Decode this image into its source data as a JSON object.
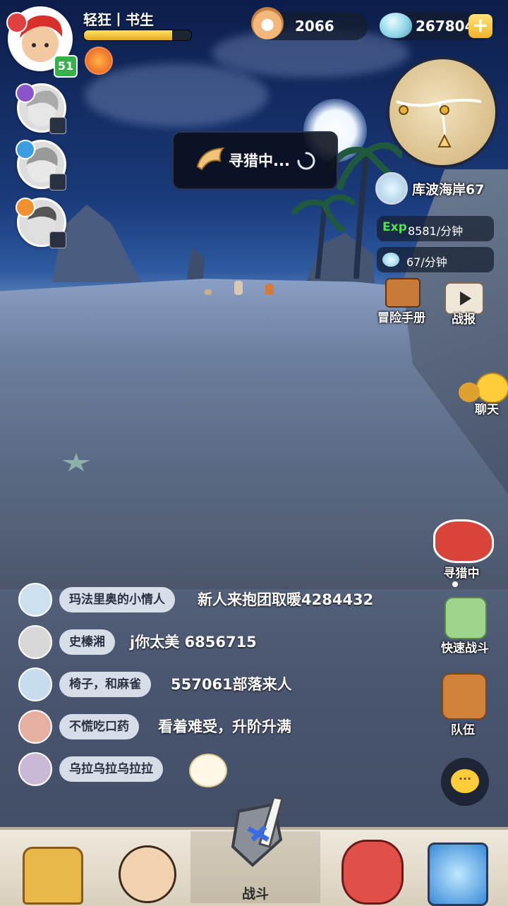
{
  "player": {
    "name": "轻狂丨书生",
    "level": "51",
    "xp_fraction": 0.82
  },
  "currency": {
    "pearls": "2066",
    "gems": "267804"
  },
  "hunting_popup": {
    "label": "寻猎中..."
  },
  "location": {
    "name": "库波海岸67"
  },
  "rates": {
    "exp_tag": "Exp",
    "exp_rate": "8581/分钟",
    "gem_rate": "67/分钟"
  },
  "side_buttons": {
    "adventure_manual": "冒险手册",
    "battle_report": "战报",
    "chat": "聊天",
    "hunting": "寻猎中",
    "quick_battle": "快速战斗",
    "team": "队伍"
  },
  "chat": [
    {
      "name": "玛法里奥的小情人",
      "message": "新人来抱团取暖4284432"
    },
    {
      "name": "史榛湘",
      "message": "j你太美 6856715"
    },
    {
      "name": "椅子，和麻雀",
      "message": "557061部落来人"
    },
    {
      "name": "不慌吃口药",
      "message": "看着难受，升阶升满"
    },
    {
      "name": "乌拉乌拉乌拉拉",
      "message": ""
    }
  ],
  "nav": {
    "battle_label": "战斗"
  },
  "colors": {
    "xp": "#e4a91e",
    "level_badge": "#36b14a",
    "exp_tag": "#4fe04f"
  }
}
